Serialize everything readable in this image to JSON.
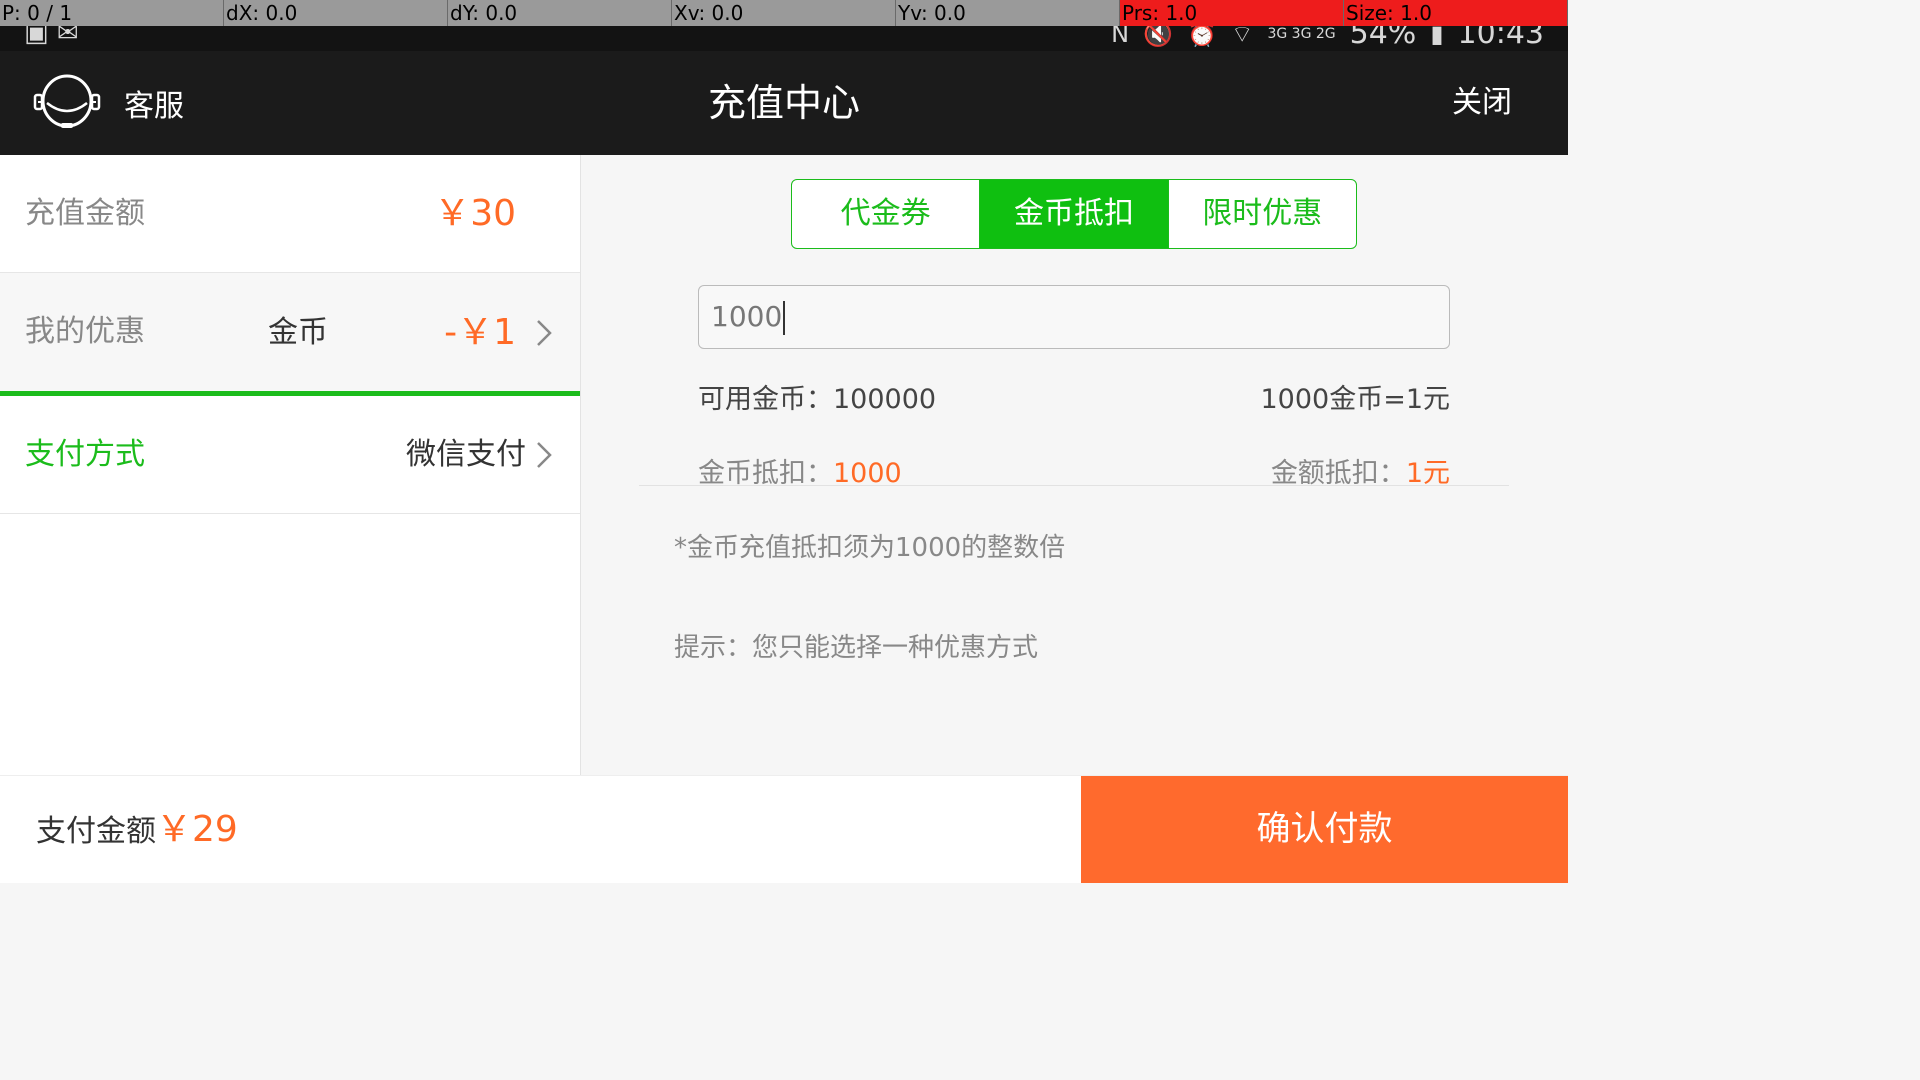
{
  "debug_overlay": {
    "pointer": "P: 0 / 1",
    "dx": "dX: 0.0",
    "dy": "dY: 0.0",
    "xv": "Xv: 0.0",
    "yv": "Yv: 0.0",
    "prs": "Prs: 1.0",
    "size": "Size: 1.0"
  },
  "status_bar": {
    "battery": "54%",
    "time": "10:43",
    "network": "3G 3G 2G"
  },
  "header": {
    "customer_service_label": "客服",
    "title": "充值中心",
    "close_label": "关闭"
  },
  "left_panel": {
    "amount": {
      "label": "充值金额",
      "value": "￥30"
    },
    "discount": {
      "label": "我的优惠",
      "type": "金币",
      "value": "-￥1"
    },
    "payment": {
      "label": "支付方式",
      "value": "微信支付"
    }
  },
  "right_panel": {
    "tabs": [
      {
        "label": "代金券",
        "active": false
      },
      {
        "label": "金币抵扣",
        "active": true
      },
      {
        "label": "限时优惠",
        "active": false
      }
    ],
    "coin_input_value": "1000",
    "available_label": "可用金币：",
    "available_value": "100000",
    "rate": "1000金币=1元",
    "coin_deduct_label": "金币抵扣：",
    "coin_deduct_value": "1000",
    "amount_deduct_label": "金额抵扣：",
    "amount_deduct_value": "1元",
    "note": "*金币充值抵扣须为1000的整数倍",
    "hint": "提示：您只能选择一种优惠方式"
  },
  "footer": {
    "pay_label": "支付金额",
    "pay_value": "￥29",
    "confirm_label": "确认付款"
  },
  "colors": {
    "accent_green": "#1bbc1b",
    "accent_orange": "#ff6a26",
    "header_bg": "#1b1b1b"
  }
}
